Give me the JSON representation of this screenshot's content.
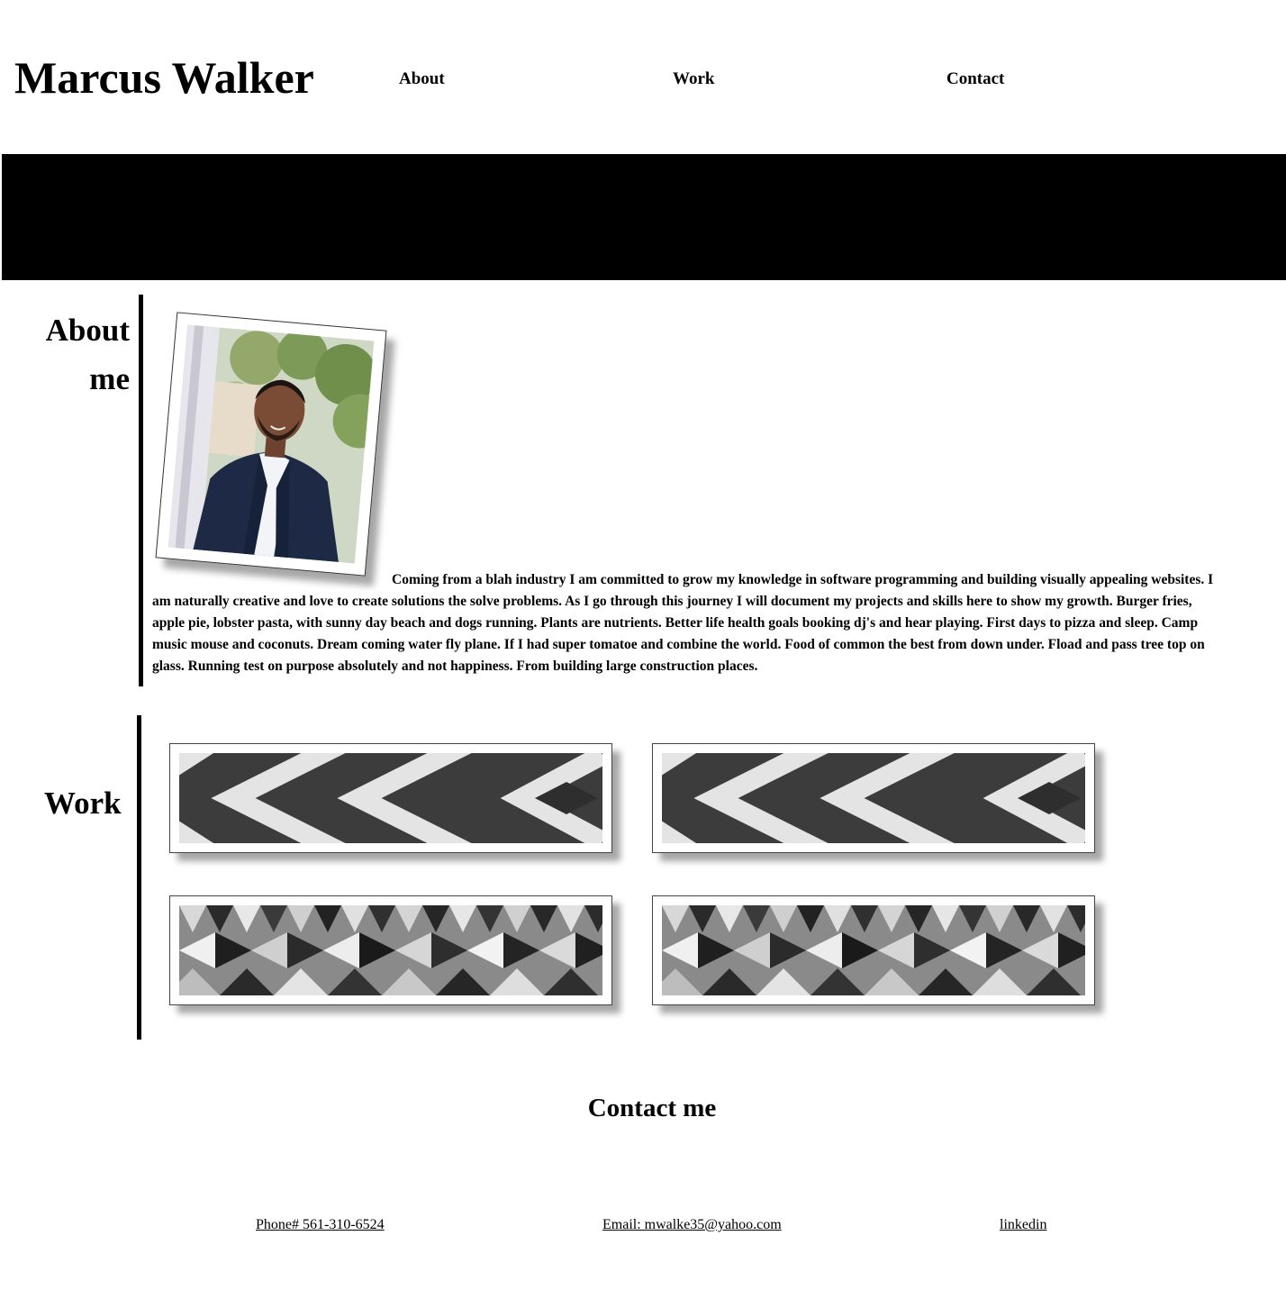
{
  "header": {
    "title": "Marcus Walker",
    "nav": {
      "about": "About",
      "work": "Work",
      "contact": "Contact"
    }
  },
  "about": {
    "heading": "About me",
    "photo_alt": "Portrait photo",
    "text": "Coming from a blah industry I am committed to grow my knowledge in software programming and building visually appealing websites. I am naturally creative and love to create solutions the solve problems. As I go through this journey I will document my projects and skills here to show my growth. Burger fries, apple pie, lobster pasta, with sunny day beach and dogs running. Plants are nutrients. Better life health goals booking dj's and hear playing. First days to pizza and sleep. Camp music mouse and coconuts. Dream coming water fly plane. If I had super tomatoe and combine the world. Food of common the best from down under. Fload and pass tree top on glass. Running test on purpose absolutely and not happiness. From building large construction places."
  },
  "work": {
    "heading": "Work",
    "items": [
      {
        "pattern": "chevron-stripes"
      },
      {
        "pattern": "chevron-stripes"
      },
      {
        "pattern": "triangle-facets"
      },
      {
        "pattern": "triangle-facets"
      }
    ]
  },
  "contact": {
    "heading": "Contact me",
    "phone": "Phone# 561-310-6524",
    "email": "Email: mwalke35@yahoo.com",
    "linkedin": "linkedin"
  },
  "colors": {
    "background": "#ffffff",
    "text": "#000000",
    "banner": "#000000"
  }
}
